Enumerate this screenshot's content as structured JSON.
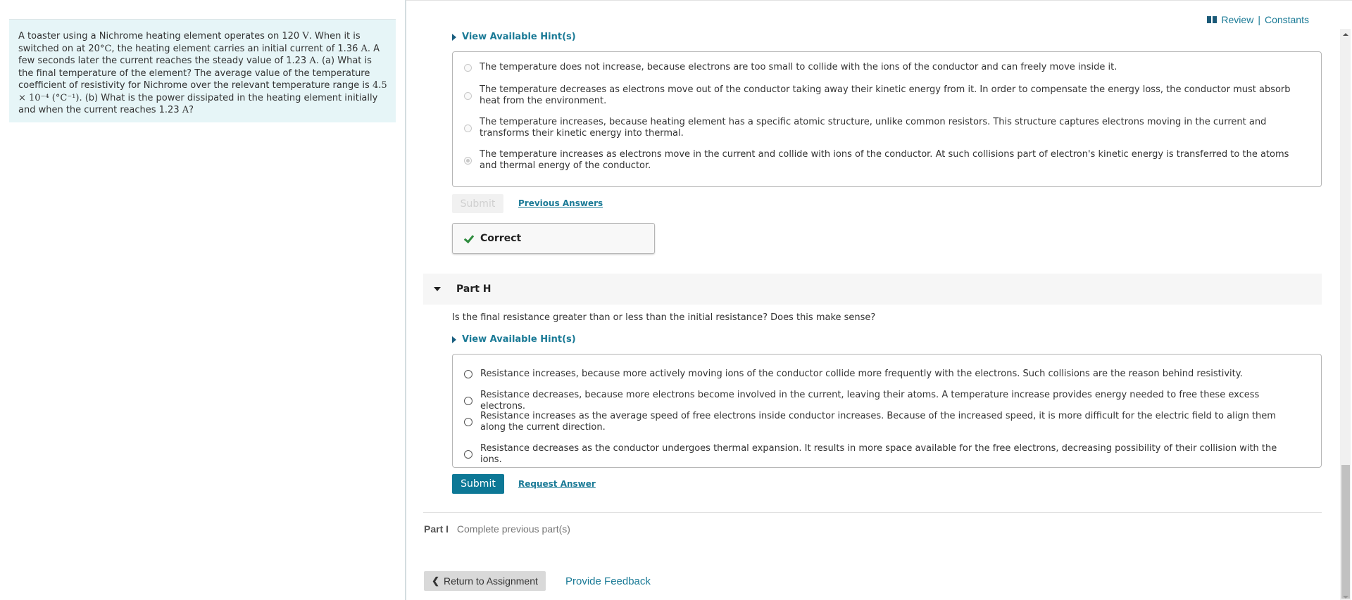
{
  "problem": {
    "segments": [
      {
        "t": "A toaster using a Nichrome heating element operates on 120 "
      },
      {
        "m": "V"
      },
      {
        "t": ". When it is switched on at 20"
      },
      {
        "m": "°C"
      },
      {
        "t": ", the heating element carries an initial current of 1.36 "
      },
      {
        "m": "A"
      },
      {
        "t": ". A few seconds later the current reaches the steady value of 1.23 "
      },
      {
        "m": "A"
      },
      {
        "t": ". (a) What is the final temperature of the element? The average value of the temperature coefficient of resistivity for Nichrome over the relevant temperature range is "
      },
      {
        "m": "4.5 × 10⁻⁴ (°C⁻¹)"
      },
      {
        "t": ". (b) What is the power dissipated in the heating element initially and when the current reaches 1.23 "
      },
      {
        "m": "A"
      },
      {
        "t": "?"
      }
    ]
  },
  "header": {
    "review_icon": "book-icon",
    "review_label": "Review",
    "separator": "|",
    "constants_label": "Constants"
  },
  "part_g": {
    "hint_label": "View Available Hint(s)",
    "choices": [
      {
        "text": "The temperature does not increase, because electrons are too small to collide with the ions of the conductor and can freely move inside it.",
        "selected": false
      },
      {
        "text": "The temperature decreases as electrons move out of the conductor taking away their kinetic energy from it. In order to compensate the energy loss, the conductor must absorb heat from the environment.",
        "selected": false
      },
      {
        "text": "The temperature increases, because heating element has a specific atomic structure, unlike common resistors. This structure captures electrons moving in the current and transforms their kinetic energy into thermal.",
        "selected": false
      },
      {
        "text": "The temperature increases as electrons move in the current and collide with ions of the conductor. At such collisions part of electron's kinetic energy is transferred to the atoms and thermal energy of the conductor.",
        "selected": true
      }
    ],
    "submit_label": "Submit",
    "previous_answers_label": "Previous Answers",
    "result_label": "Correct",
    "result_icon": "checkmark-icon",
    "result_color": "#2e8b3e"
  },
  "part_h": {
    "title": "Part H",
    "question": "Is the final resistance greater than or less than the initial resistance? Does this make sense?",
    "hint_label": "View Available Hint(s)",
    "choices": [
      {
        "text": "Resistance increases, because more actively moving ions of the conductor collide more frequently with the electrons. Such collisions are the reason behind resistivity.",
        "selected": false
      },
      {
        "text": "Resistance decreases, because more electrons become involved in the current, leaving their atoms. A temperature increase provides energy needed to free these excess electrons.",
        "selected": false
      },
      {
        "text": "Resistance increases as the average speed of free electrons inside conductor increases. Because of the increased speed, it is more difficult for the electric field to align them along the current direction.",
        "selected": false
      },
      {
        "text": "Resistance decreases as the conductor undergoes thermal expansion. It results in more space available for the free electrons, decreasing possibility of their collision with the ions.",
        "selected": false
      }
    ],
    "submit_label": "Submit",
    "request_answer_label": "Request Answer"
  },
  "part_i": {
    "title": "Part I",
    "status": "Complete previous part(s)"
  },
  "footer": {
    "return_label": "Return to Assignment",
    "feedback_label": "Provide Feedback"
  },
  "colors": {
    "accent": "#0d7896",
    "link": "#1a7a96",
    "problem_bg": "#e6f5f7"
  }
}
